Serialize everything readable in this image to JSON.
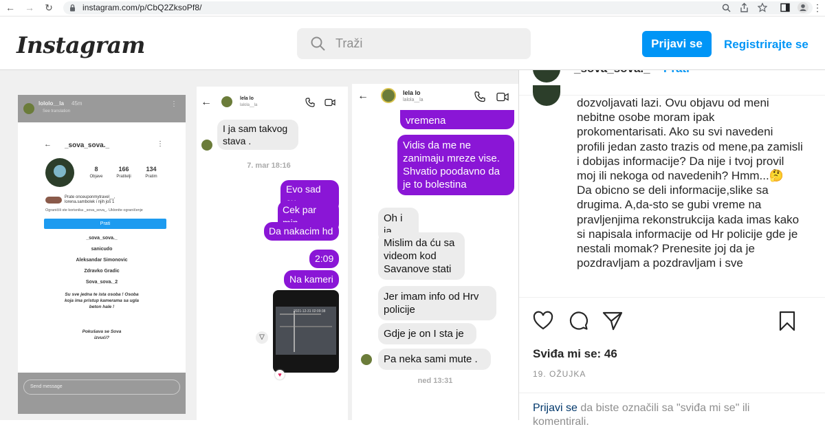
{
  "browser": {
    "url": "instagram.com/p/CbQ2ZksoPf8/"
  },
  "header": {
    "logo": "Instagram",
    "search_placeholder": "Traži",
    "login": "Prijavi se",
    "register": "Registrirajte se"
  },
  "story": {
    "top_user": "lololo__la",
    "top_time": "45m",
    "top_sub": "See translation",
    "username": "_sova_sova._",
    "posts": "8",
    "posts_label": "Objave",
    "followers": "166",
    "followers_label": "Pratitelji",
    "following": "134",
    "following_label": "Pratim",
    "followed_by": "Prate onceuponmytravel__,",
    "followed_by2": "lorena.sambolek i njih još 1",
    "restricted": "Ograničili ste korisnika _sova_sova_. Uklonite ograničenje",
    "follow": "Prati",
    "names": [
      "_sova_sova._",
      "sanicudo",
      "Aleksandar Simonovic",
      "Zdravko Gradic",
      "Sova_sova._2"
    ],
    "message1": "Su sve jedna te ista osoba ! Osoba koja ima pristup kamerama sa ugla beton hale !",
    "message2": "Pokušava se Sova izvući?",
    "send": "Send message"
  },
  "chat1": {
    "name": "lela lo",
    "handle": "lalola__la",
    "msg_in": "I ja sam takvog stava .",
    "timestamp": "7. mar 18:16",
    "msgs_out": [
      "Evo sad cu",
      "Cek par min",
      "Da nakacim hd",
      "2:09",
      "Na kameri"
    ],
    "video_time": "2021-12-31 02:09:38"
  },
  "chat2": {
    "name": "lela lo",
    "handle": "lalola__la",
    "out_top": "vremena",
    "out_main": "Vidis da me ne zanimaju mreze vise. Shvatio poodavno da je to bolestina",
    "msgs_in": [
      "Oh i ja",
      "Mislim da ću sa videom kod Savanove stati",
      "Jer imam info od Hrv policije",
      "Gdje je on I sta je",
      "Pa neka sami mute ."
    ],
    "timestamp": "ned 13:31"
  },
  "post": {
    "username": "_sova_sova._",
    "follow": "Prati",
    "caption": "dozvoljavati lazi. Ovu objavu od meni nebitne osobe moram ipak prokomentarisati. Ako su svi navedeni profili jedan zasto trazis od mene,pa zamisli i dobijas informacije? Da nije i tvoj provil moj ili nekoga od navedenih? Hmm...🤔\nDa obicno se deli informacije,slike sa drugima. A,da-sto se gubi vreme na pravljenjima rekonstrukcija kada imas kako si napisala informacije od Hr policije gde je nestali momak? Prenesite joj da je pozdravljam a pozdravljam i sve",
    "likes": "Sviđa mi se: 46",
    "date": "19. OŽUJKA",
    "login_link": "Prijavi se",
    "login_rest": " da biste označili sa \"sviđa mi se\" ili komentirali."
  }
}
